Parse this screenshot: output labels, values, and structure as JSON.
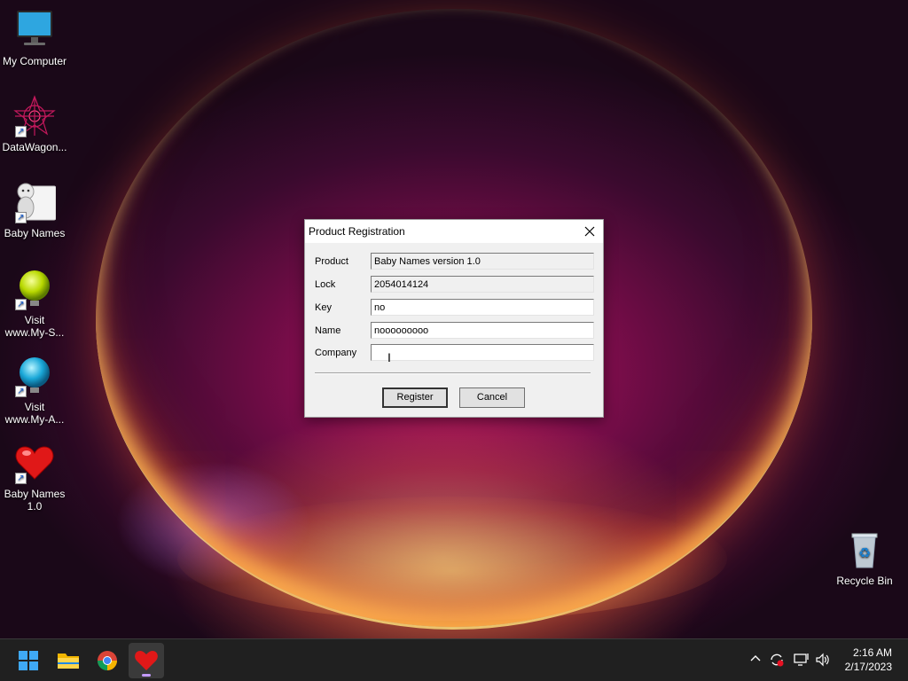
{
  "desktop": {
    "icons": [
      {
        "label": "My Computer"
      },
      {
        "label": "DataWagon..."
      },
      {
        "label": "Baby Names"
      },
      {
        "label_line1": "Visit",
        "label_line2": "www.My-S..."
      },
      {
        "label_line1": "Visit",
        "label_line2": "www.My-A..."
      },
      {
        "label_line1": "Baby Names",
        "label_line2": "1.0"
      },
      {
        "label": "Recycle Bin"
      }
    ]
  },
  "dialog": {
    "title": "Product Registration",
    "fields": [
      {
        "label": "Product",
        "value": "Baby Names version 1.0",
        "readonly": true
      },
      {
        "label": "Lock",
        "value": "2054014124",
        "readonly": true
      },
      {
        "label": "Key",
        "value": "no",
        "readonly": false
      },
      {
        "label": "Name",
        "value": "nooooooooo",
        "readonly": false
      },
      {
        "label": "Company",
        "value": "",
        "readonly": false
      }
    ],
    "register_label": "Register",
    "cancel_label": "Cancel"
  },
  "taskbar": {
    "apps": [
      "start-icon",
      "file-explorer-icon",
      "chrome-icon",
      "baby-names-icon"
    ],
    "active_app": "baby-names-icon",
    "tray_icons": [
      "chevron-up-icon",
      "sync-icon",
      "network-icon",
      "volume-icon"
    ],
    "time": "2:16 AM",
    "date": "2/17/2023"
  }
}
